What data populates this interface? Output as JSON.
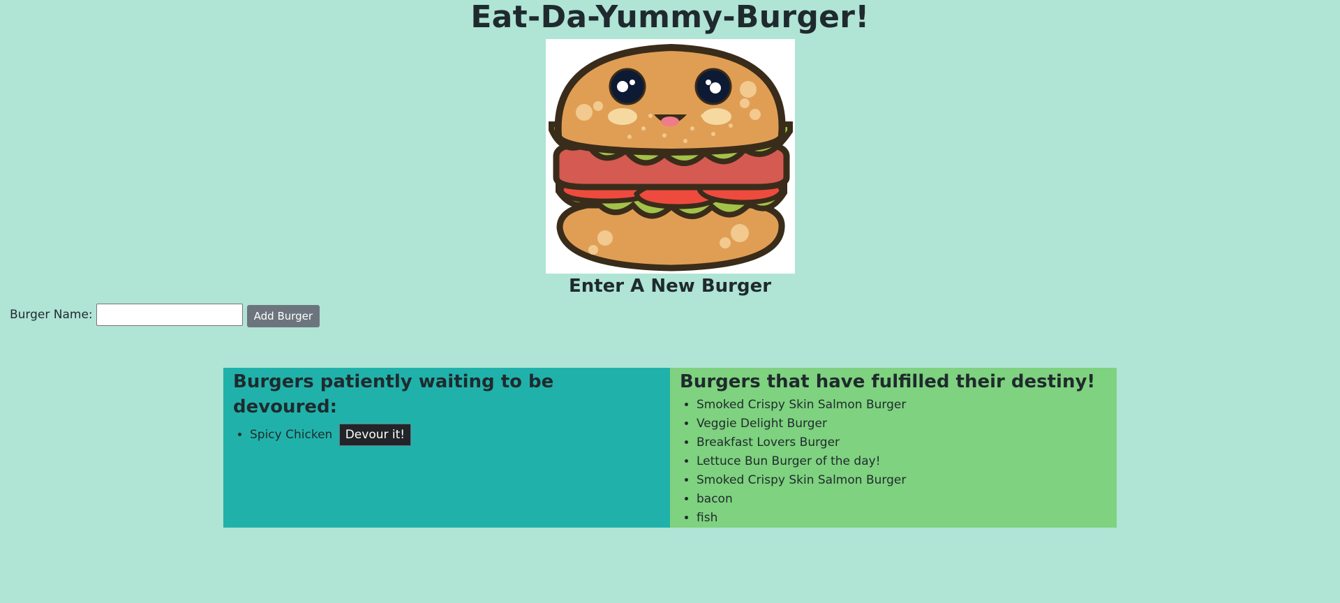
{
  "header": {
    "title": "Eat-Da-Yummy-Burger!"
  },
  "form": {
    "heading": "Enter A New Burger",
    "label": "Burger Name:",
    "input_value": "",
    "submit_label": "Add Burger"
  },
  "waiting": {
    "heading": "Burgers patiently waiting to be devoured:",
    "items": [
      {
        "name": "Spicy Chicken",
        "action_label": "Devour it!"
      }
    ]
  },
  "devoured": {
    "heading": "Burgers that have fulfilled their destiny!",
    "items": [
      "Smoked Crispy Skin Salmon Burger",
      "Veggie Delight Burger",
      "Breakfast Lovers Burger",
      "Lettuce Bun Burger of the day!",
      "Smoked Crispy Skin Salmon Burger",
      "bacon",
      "fish"
    ]
  },
  "colors": {
    "background": "#b0e4d5",
    "waiting_panel": "#20b2aa",
    "devoured_panel": "#7fd27f",
    "add_button": "#6c757d",
    "devour_button": "#212529"
  },
  "image": {
    "icon": "burger-mascot-illustration"
  }
}
